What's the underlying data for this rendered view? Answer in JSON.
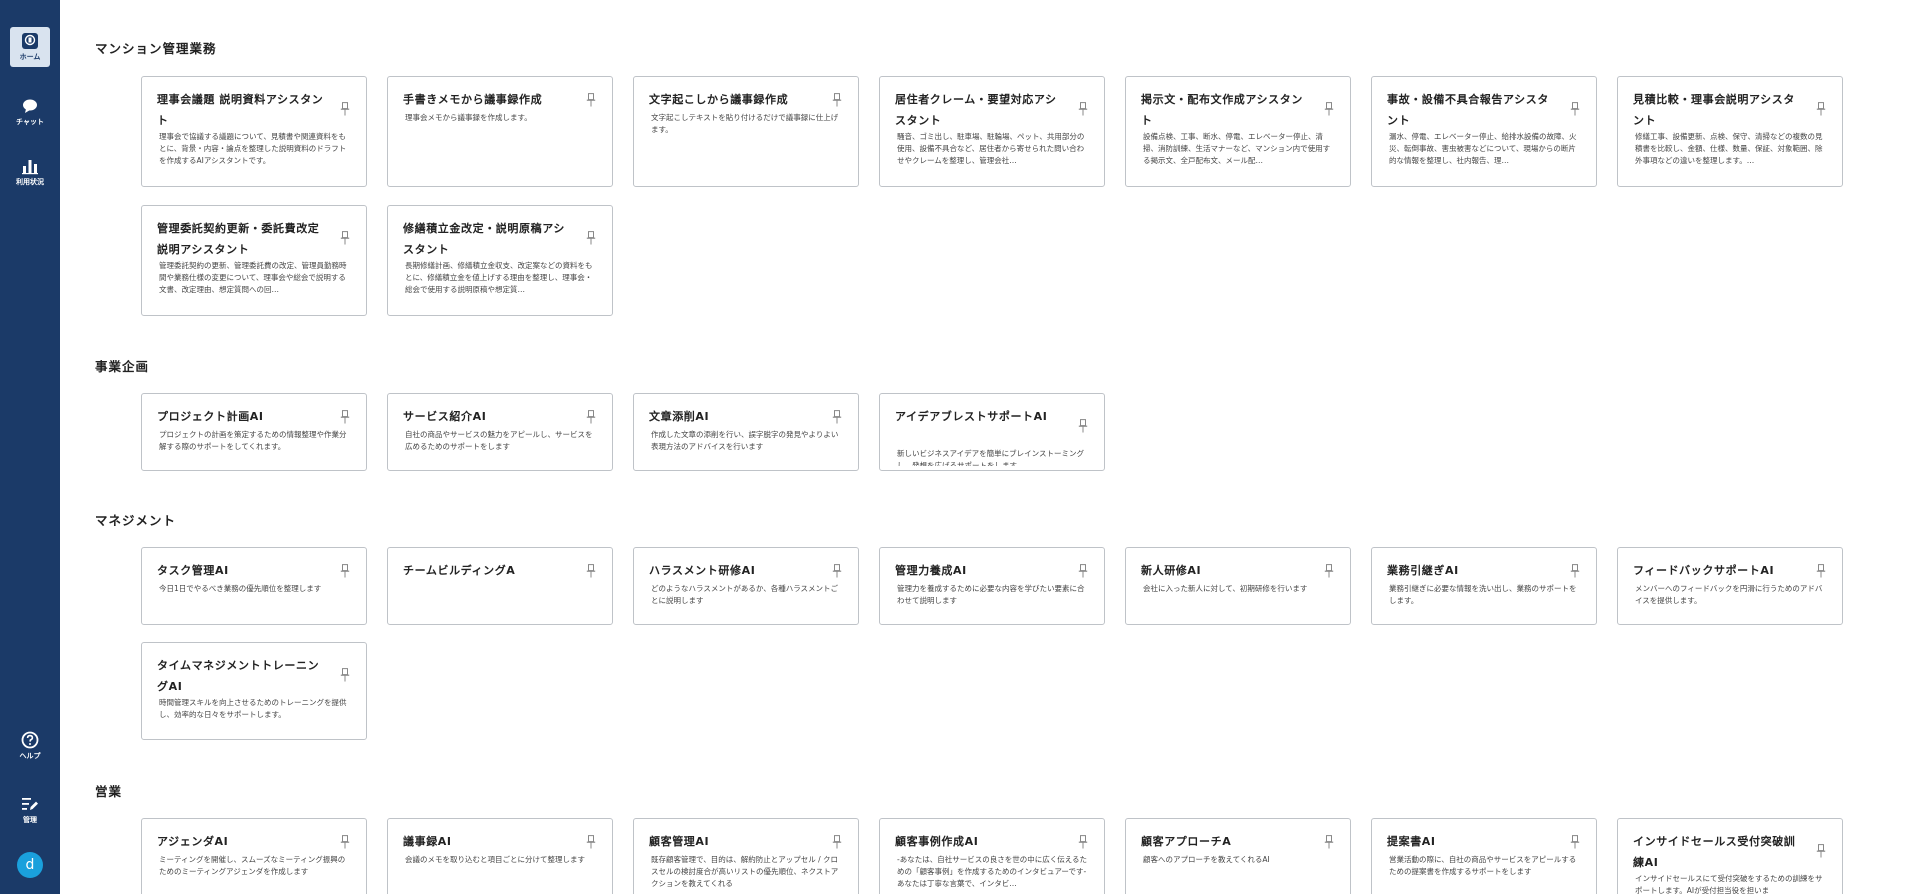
{
  "sidebar": {
    "items": [
      {
        "label": "ホーム",
        "icon": "home-icon"
      },
      {
        "label": "チャット",
        "icon": "chat-icon"
      },
      {
        "label": "利用状況",
        "icon": "bar-chart-icon"
      }
    ],
    "bottom": [
      {
        "label": "ヘルプ",
        "icon": "help-icon"
      },
      {
        "label": "管理",
        "icon": "admin-edit-icon"
      }
    ],
    "avatar": "d"
  },
  "sections": [
    {
      "title": "マンション管理業務",
      "cards": [
        {
          "title": "理事会議題 説明資料アシスタント",
          "desc": "理事会で協議する議題について、見積書や関連資料をもとに、背景・内容・論点を整理した説明資料のドラフトを作成するAIアシスタントです。"
        },
        {
          "title": "手書きメモから議事録作成",
          "desc": "理事会メモから議事録を作成します。"
        },
        {
          "title": "文字起こしから議事録作成",
          "desc": "文字起こしテキストを貼り付けるだけで議事録に仕上げます。"
        },
        {
          "title": "居住者クレーム・要望対応アシスタント",
          "desc": "騒音、ゴミ出し、駐車場、駐輪場、ペット、共用部分の使用、設備不具合など、居住者から寄せられた問い合わせやクレームを整理し、管理会社…"
        },
        {
          "title": "掲示文・配布文作成アシスタント",
          "desc": "設備点検、工事、断水、停電、エレベーター停止、清掃、消防訓練、生活マナーなど、マンション内で使用する掲示文、全戸配布文、メール配…"
        },
        {
          "title": "事故・設備不具合報告アシスタント",
          "desc": "漏水、停電、エレベーター停止、給排水設備の故障、火災、転倒事故、害虫被害などについて、現場からの断片的な情報を整理し、社内報告、理…"
        },
        {
          "title": "見積比較・理事会説明アシスタント",
          "desc": "修繕工事、設備更新、点検、保守、清掃などの複数の見積書を比較し、金額、仕様、数量、保証、対象範囲、除外事項などの違いを整理します。…"
        },
        {
          "title": "管理委託契約更新・委託費改定説明アシスタント",
          "desc": "管理委託契約の更新、管理委託費の改定、管理員勤務時間や業務仕様の変更について、理事会や総会で説明する文書、改定理由、想定質問への回…"
        },
        {
          "title": "修繕積立金改定・説明原稿アシスタント",
          "desc": "長期修繕計画、修繕積立金収支、改定案などの資料をもとに、修繕積立金を値上げする理由を整理し、理事会・総会で使用する説明原稿や想定質…"
        }
      ]
    },
    {
      "title": "事業企画",
      "cards": [
        {
          "title": "プロジェクト計画AI",
          "desc": "プロジェクトの計画を策定するための情報整理や作業分解する際のサポートをしてくれます。"
        },
        {
          "title": "サービス紹介AI",
          "desc": "自社の商品やサービスの魅力をアピールし、サービスを広めるためのサポートをします"
        },
        {
          "title": "文章添削AI",
          "desc": "作成した文章の添削を行い、誤字脱字の発見やよりよい表現方法のアドバイスを行います"
        },
        {
          "title": "アイデアブレストサポートAI",
          "desc": "新しいビジネスアイデアを簡単にブレインストーミングし、発想を広げるサポートをします。"
        }
      ]
    },
    {
      "title": "マネジメント",
      "cards": [
        {
          "title": "タスク管理AI",
          "desc": "今日1日でやるべき業務の優先順位を整理します"
        },
        {
          "title": "チームビルディングA",
          "desc": ""
        },
        {
          "title": "ハラスメント研修AI",
          "desc": "どのようなハラスメントがあるか、各種ハラスメントごとに説明します"
        },
        {
          "title": "管理力養成AI",
          "desc": "管理力を養成するために必要な内容を学びたい要素に合わせて説明します"
        },
        {
          "title": "新人研修AI",
          "desc": "会社に入った新人に対して、初期研修を行います"
        },
        {
          "title": "業務引継ぎAI",
          "desc": "業務引継ぎに必要な情報を洗い出し、業務のサポートをします。"
        },
        {
          "title": "フィードバックサポートAI",
          "desc": "メンバーへのフィードバックを円滑に行うためのアドバイスを提供します。"
        },
        {
          "title": "タイムマネジメントトレーニングAI",
          "desc": "時間管理スキルを向上させるためのトレーニングを提供し、効率的な日々をサポートします。"
        }
      ]
    },
    {
      "title": "営業",
      "cards": [
        {
          "title": "アジェンダAI",
          "desc": "ミーティングを開催し、スムーズなミーティング振興のためのミーティングアジェンダを作成します"
        },
        {
          "title": "議事録AI",
          "desc": "会議のメモを取り込むと項目ごとに分けて整理します"
        },
        {
          "title": "顧客管理AI",
          "desc": "既存顧客管理で、目的は、解約防止とアップセル / クロスセルの検討度合が高いリストの優先順位、ネクストアクションを教えてくれる"
        },
        {
          "title": "顧客事例作成AI",
          "desc": "-あなたは、自社サービスの良さを世の中に広く伝えるための「顧客事例」を作成するためのインタビュアーです-あなたは丁寧な言葉で、インタビ…"
        },
        {
          "title": "顧客アプローチA",
          "desc": "顧客へのアプローチを教えてくれるAI"
        },
        {
          "title": "提案書AI",
          "desc": "営業活動の際に、自社の商品やサービスをアピールするための提案書を作成するサポートをします"
        },
        {
          "title": "インサイドセールス受付突破訓練AI",
          "desc": "インサイドセールスにて受付突破をするための訓練をサポートします。AIが受付担当役を担いま"
        }
      ]
    }
  ]
}
